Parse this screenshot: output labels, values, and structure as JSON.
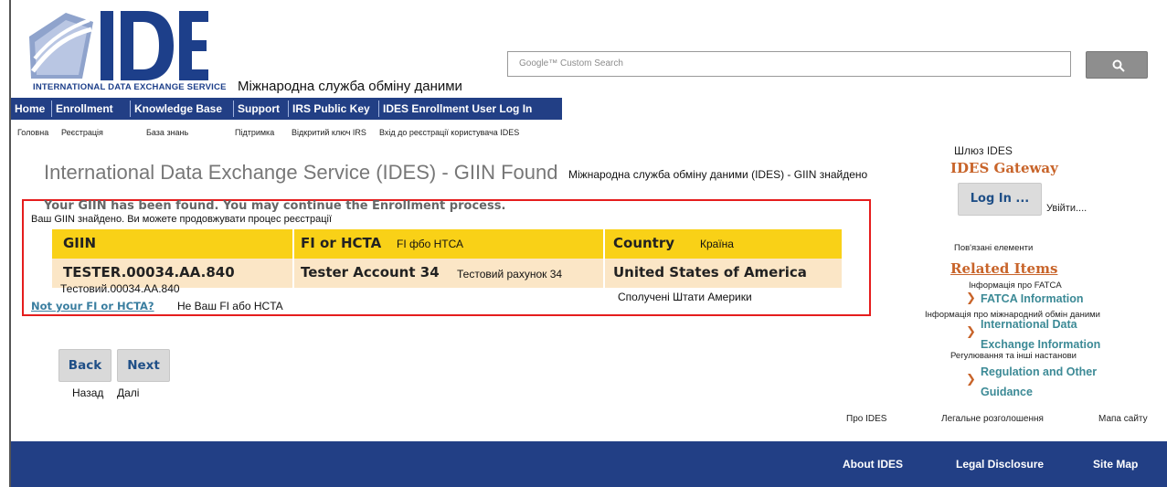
{
  "header": {
    "logo_text": "IDES",
    "logo_subtitle": "INTERNATIONAL DATA EXCHANGE SERVICE",
    "logo_subtitle_uk": "Міжнародна служба обміну даними",
    "search_placeholder": "Google™ Custom Search",
    "search_button_icon": "search-icon"
  },
  "nav": {
    "items": [
      "Home",
      "Enrollment",
      "Knowledge Base",
      "Support",
      "IRS Public Key",
      "IDES Enrollment User Log In"
    ],
    "translations": [
      "Головна",
      "Реєстрація",
      "База знань",
      "Підтримка",
      "Відкритий ключ IRS",
      "Вхід до реєстрації користувача IDES"
    ]
  },
  "main": {
    "title": "International Data Exchange Service (IDES) - GIIN Found",
    "title_uk": "Міжнародна служба обміну даними (IDES) - GIIN знайдено",
    "found_message": "Your GIIN has been found. You may continue the Enrollment process.",
    "found_message_uk": "Ваш GIIN знайдено. Ви можете продовжувати процес реєстрації",
    "table": {
      "headers": [
        "GIIN",
        "FI or HCTA",
        "Country"
      ],
      "headers_uk": [
        "",
        "FI фбо НТСА",
        "Країна"
      ],
      "row": [
        "TESTER.00034.AA.840",
        "Tester Account 34",
        "United States of America"
      ],
      "row_uk": [
        "Тестовий.00034.AA.840",
        "Тестовий рахунок 34",
        "Сполучені Штати Америки"
      ]
    },
    "not_your_link": "Not your FI or HCTA?",
    "not_your_link_uk": "Не Ваш FI або HCTA",
    "back_label": "Back",
    "back_label_uk": "Назад",
    "next_label": "Next",
    "next_label_uk": "Далі"
  },
  "sidebar": {
    "gateway_title_uk": "Шлюз IDES",
    "gateway_title": "IDES Gateway",
    "login_label": "Log In ...",
    "login_label_uk": "Увійти....",
    "related_title_uk": "Пов'язані елементи",
    "related_title": "Related Items",
    "links": [
      {
        "uk": "Інформація про FATCA",
        "label": "FATCA Information"
      },
      {
        "uk": "Інформація про міжнародний обмін даними",
        "line1": "International Data",
        "line2": "Exchange Information"
      },
      {
        "uk": "Регулювання та інші настанови",
        "line1": "Regulation and Other",
        "line2": "Guidance"
      }
    ]
  },
  "footer": {
    "links": [
      "About IDES",
      "Legal Disclosure",
      "Site Map"
    ],
    "links_uk": [
      "Про IDES",
      "Легальне розголошення",
      "Мапа сайту"
    ],
    "background_color": "#223f85"
  },
  "colors": {
    "accent_orange": "#c8642a",
    "header_row": "#f9d117",
    "value_row": "#fbe6c6",
    "highlight_border": "#e51d1d"
  }
}
